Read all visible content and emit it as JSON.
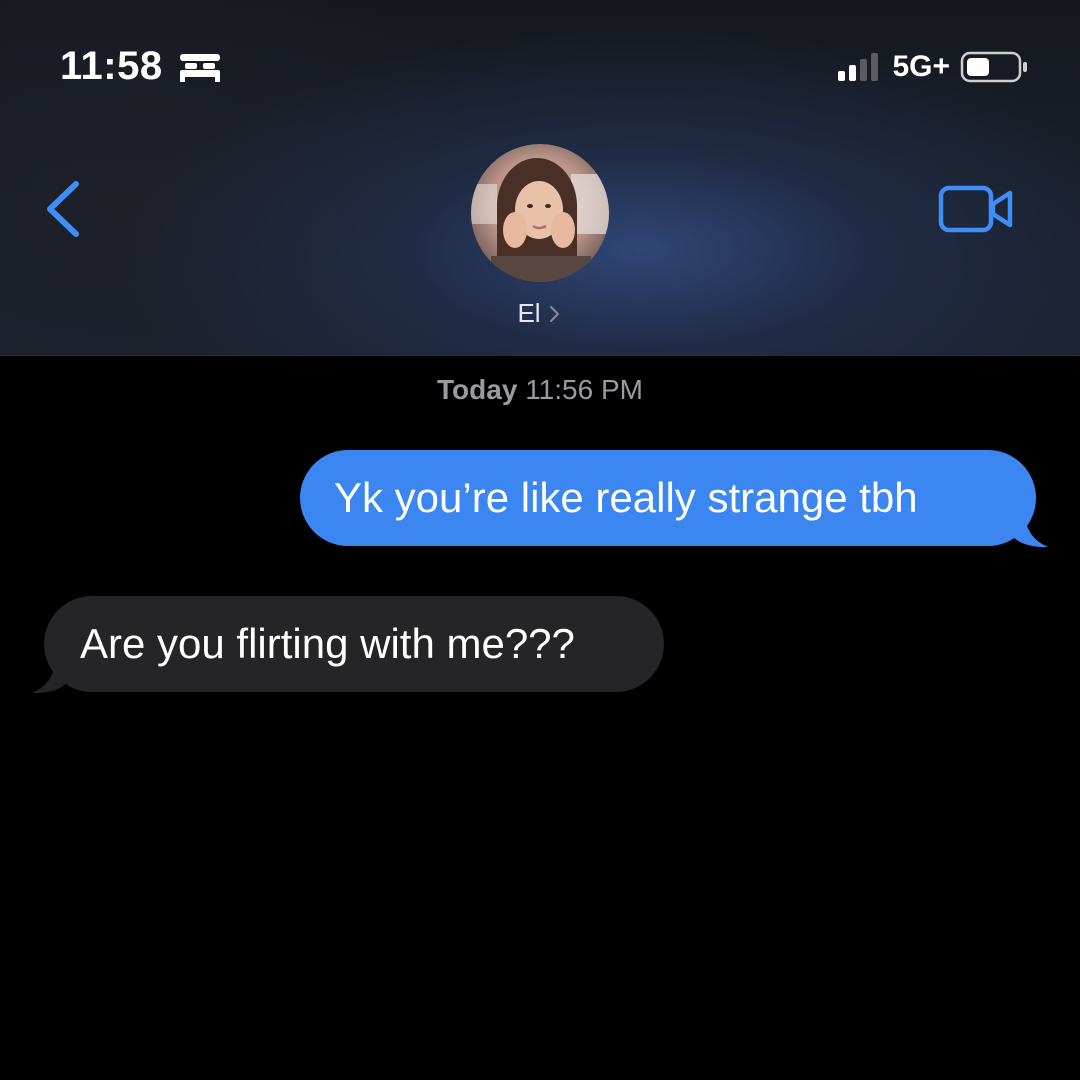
{
  "status_bar": {
    "time": "11:58",
    "focus_icon": "bed-icon",
    "network": "5G+",
    "signal_bars_active": 2,
    "signal_bars_total": 4,
    "battery_level": 0.45
  },
  "nav": {
    "back_icon": "chevron-left-icon",
    "contact_name": "El",
    "contact_chevron_icon": "chevron-right-icon",
    "video_icon": "video-camera-icon",
    "avatar_icon": "contact-avatar-photo"
  },
  "conversation": {
    "timestamp_day": "Today",
    "timestamp_time": "11:56 PM",
    "messages": [
      {
        "direction": "sent",
        "text": "Yk you’re like really strange tbh"
      },
      {
        "direction": "received",
        "text": "Are you flirting with me???"
      }
    ]
  },
  "colors": {
    "accent": "#3b86f1",
    "sent_bubble": "#3b86f1",
    "received_bubble": "#252528",
    "background": "#000000",
    "icon_blue": "#3f8ef7",
    "timestamp": "#9a9aa0"
  }
}
